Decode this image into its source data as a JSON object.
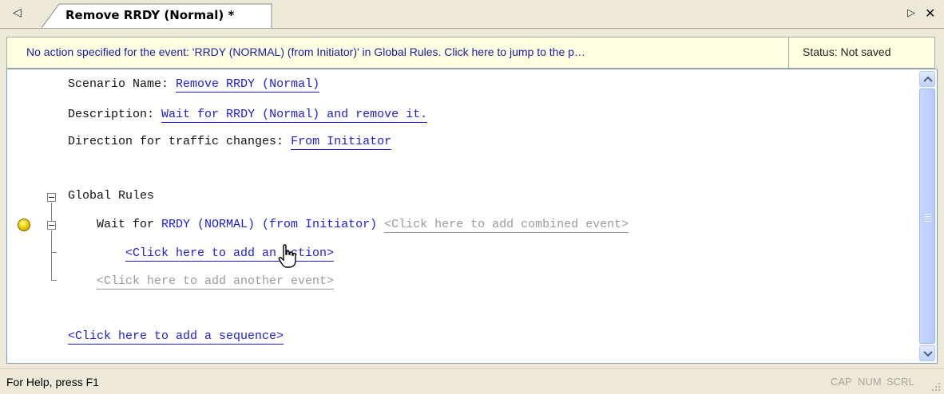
{
  "tabs": {
    "nav_left_icon": "triangle-left-icon",
    "active_label": "Remove RRDY (Normal) *",
    "nav_right_icon": "triangle-right-icon",
    "close_icon": "close-icon"
  },
  "infobar": {
    "message": "No action specified for the event: 'RRDY (NORMAL) (from Initiator)' in Global Rules.  Click here to jump to the p…",
    "status": "Status: Not saved",
    "background": "#ffffe1"
  },
  "scenario": {
    "name_label": "Scenario Name:",
    "name_value": "Remove RRDY (Normal)",
    "description_label": "Description:",
    "description_value": "Wait for RRDY (Normal) and remove it.",
    "direction_label": "Direction for traffic changes:",
    "direction_value": "From Initiator"
  },
  "global_rules": {
    "heading": "Global Rules",
    "wait_for_label": "Wait for",
    "event_value": "RRDY (NORMAL) (from Initiator)",
    "add_combined_event": "<Click here to add combined event>",
    "add_action": "<Click here to add an action>",
    "add_another_event": "<Click here to add another event>"
  },
  "add_sequence": "<Click here to add a sequence>",
  "statusbar": {
    "help_text": "For Help, press F1",
    "indicators": [
      "CAP",
      "NUM",
      "SCRL"
    ]
  },
  "colors": {
    "link": "#1c1cdc",
    "placeholder_link": "#9a9a9a",
    "breakpoint": "#f1d100"
  }
}
